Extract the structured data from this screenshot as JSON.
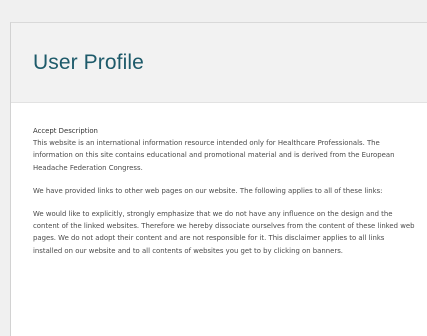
{
  "profile": {
    "title": "User Profile"
  },
  "disclaimer": {
    "heading": "Accept Description",
    "paragraph1": "This website is an international information resource intended only for Healthcare Professionals. The information on this site contains educational and promotional material and is derived from the European  Headache Federation Congress.",
    "paragraph2": "We have provided links to other web pages on our website. The following applies to all of these links:",
    "paragraph3": "We would like to explicitly, strongly emphasize that we do not have any influence on the design and the content of the linked websites. Therefore we hereby dissociate ourselves from the content of these linked web pages. We do not adopt their content and are not responsible for it. This disclaimer applies to all links installed on our website and to all contents of websites you get to by clicking on banners."
  }
}
